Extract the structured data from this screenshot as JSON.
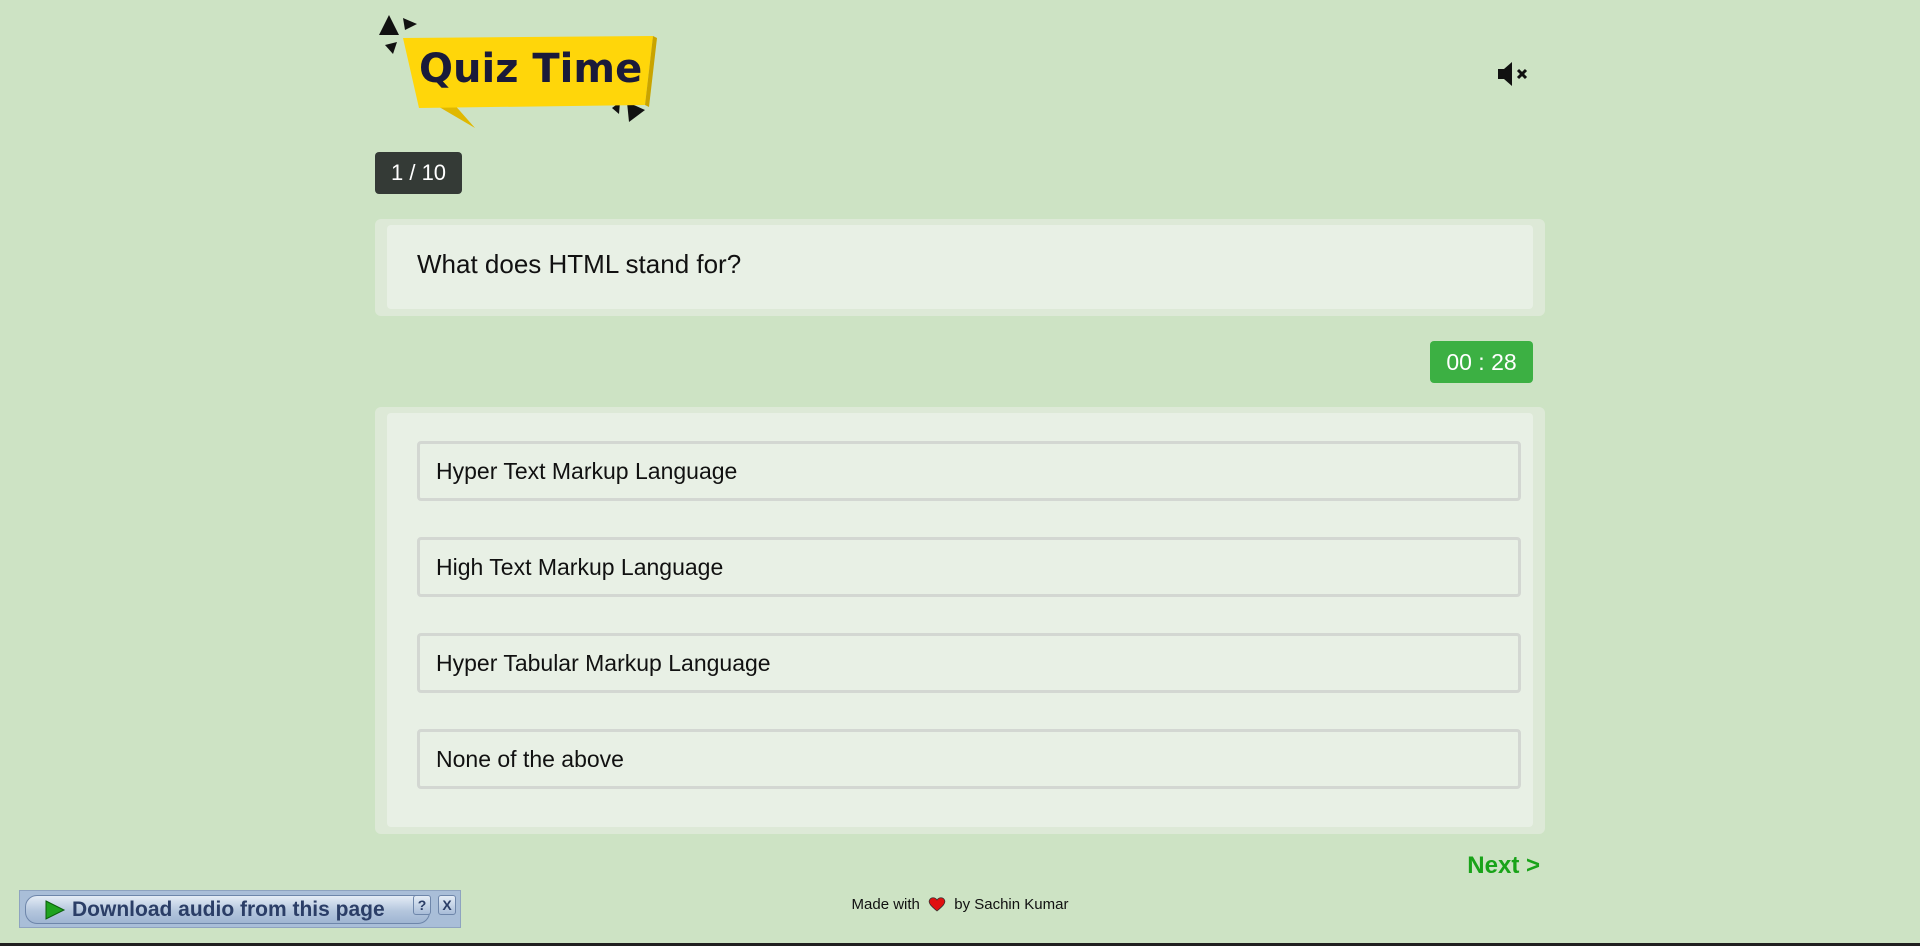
{
  "logo": {
    "text": "Quiz Time",
    "colors": {
      "banner": "#ffd60a",
      "banner_shadow": "#e0b800",
      "text": "#1a1a3a"
    }
  },
  "header": {
    "mute_icon": "speaker-muted-icon"
  },
  "quiz": {
    "progress": "1 / 10",
    "question": "What does HTML stand for?",
    "timer": "00 : 28",
    "options": [
      "Hyper Text Markup Language",
      "High Text Markup Language",
      "Hyper Tabular Markup Language",
      "None of the above"
    ],
    "next_label": "Next >"
  },
  "footer": {
    "prefix": "Made with",
    "suffix": "by Sachin Kumar",
    "heart_icon": "heart-icon"
  },
  "download_bar": {
    "label": "Download audio from this page",
    "help": "?",
    "close": "X"
  },
  "colors": {
    "background": "#cde3c4",
    "timer": "#3cb043",
    "next": "#19a319",
    "badge": "#343a36"
  }
}
